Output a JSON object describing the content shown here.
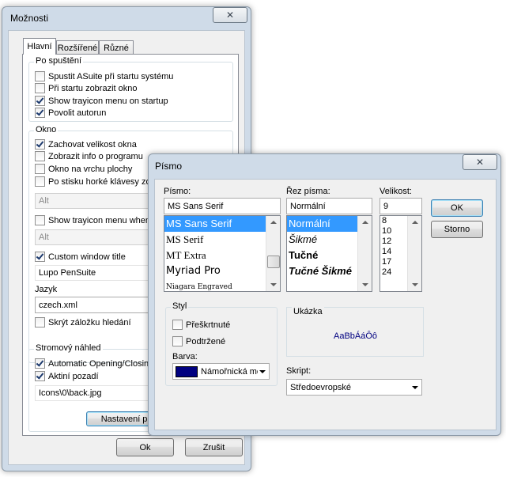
{
  "options": {
    "title": "Možnosti",
    "tabs": [
      "Hlavní",
      "Rozšířené",
      "Různé"
    ],
    "startup": {
      "label": "Po spuštění",
      "items": [
        {
          "label": "Spustit ASuite při startu systému",
          "checked": false
        },
        {
          "label": "Při startu zobrazit okno",
          "checked": false
        },
        {
          "label": "Show trayicon menu on startup",
          "checked": true
        },
        {
          "label": "Povolit autorun",
          "checked": true
        }
      ]
    },
    "window": {
      "label": "Okno",
      "items": [
        {
          "label": "Zachovat velikost okna",
          "checked": true
        },
        {
          "label": "Zobrazit info o programu",
          "checked": false
        },
        {
          "label": "Okno na vrchu plochy",
          "checked": false
        },
        {
          "label": "Po stisku horké klávesy zob",
          "checked": false
        }
      ],
      "hotkey_combo": "Alt",
      "trayicon_label": "Show trayicon menu when",
      "trayicon_combo": "Alt",
      "custom_title_label": "Custom window title",
      "custom_title_value": "Lupo PenSuite",
      "language_label": "Jazyk",
      "language_value": "czech.xml",
      "hide_search_label": "Skrýt záložku hledání"
    },
    "tree": {
      "label": "Stromový náhled",
      "auto_label": "Automatic Opening/Closing",
      "bg_label": "Aktiní pozadí",
      "bg_path": "Icons\\0\\back.jpg",
      "font_button": "Nastavení písma"
    },
    "ok": "Ok",
    "cancel": "Zrušit"
  },
  "font_dialog": {
    "title": "Písmo",
    "font_label": "Písmo:",
    "font_value": "MS Sans Serif",
    "font_list": [
      "MS Sans Serif",
      "MS Serif",
      "MT Extra",
      "Myriad Pro",
      "Niagara Engraved"
    ],
    "style_label": "Řez písma:",
    "style_value": "Normální",
    "style_list": [
      "Normální",
      "Šikmé",
      "Tučné",
      "Tučné Šikmé"
    ],
    "size_label": "Velikost:",
    "size_value": "9",
    "size_list": [
      "8",
      "10",
      "12",
      "14",
      "17",
      "24"
    ],
    "ok": "OK",
    "cancel": "Storno",
    "effects_label": "Styl",
    "strike_label": "Přeškrtnuté",
    "underline_label": "Podtržené",
    "color_label": "Barva:",
    "color_value": "Námořnická mo",
    "color_swatch": "#000080",
    "sample_label": "Ukázka",
    "sample_text": "AaBbÁáÔô",
    "script_label": "Skript:",
    "script_value": "Středoevropské"
  }
}
